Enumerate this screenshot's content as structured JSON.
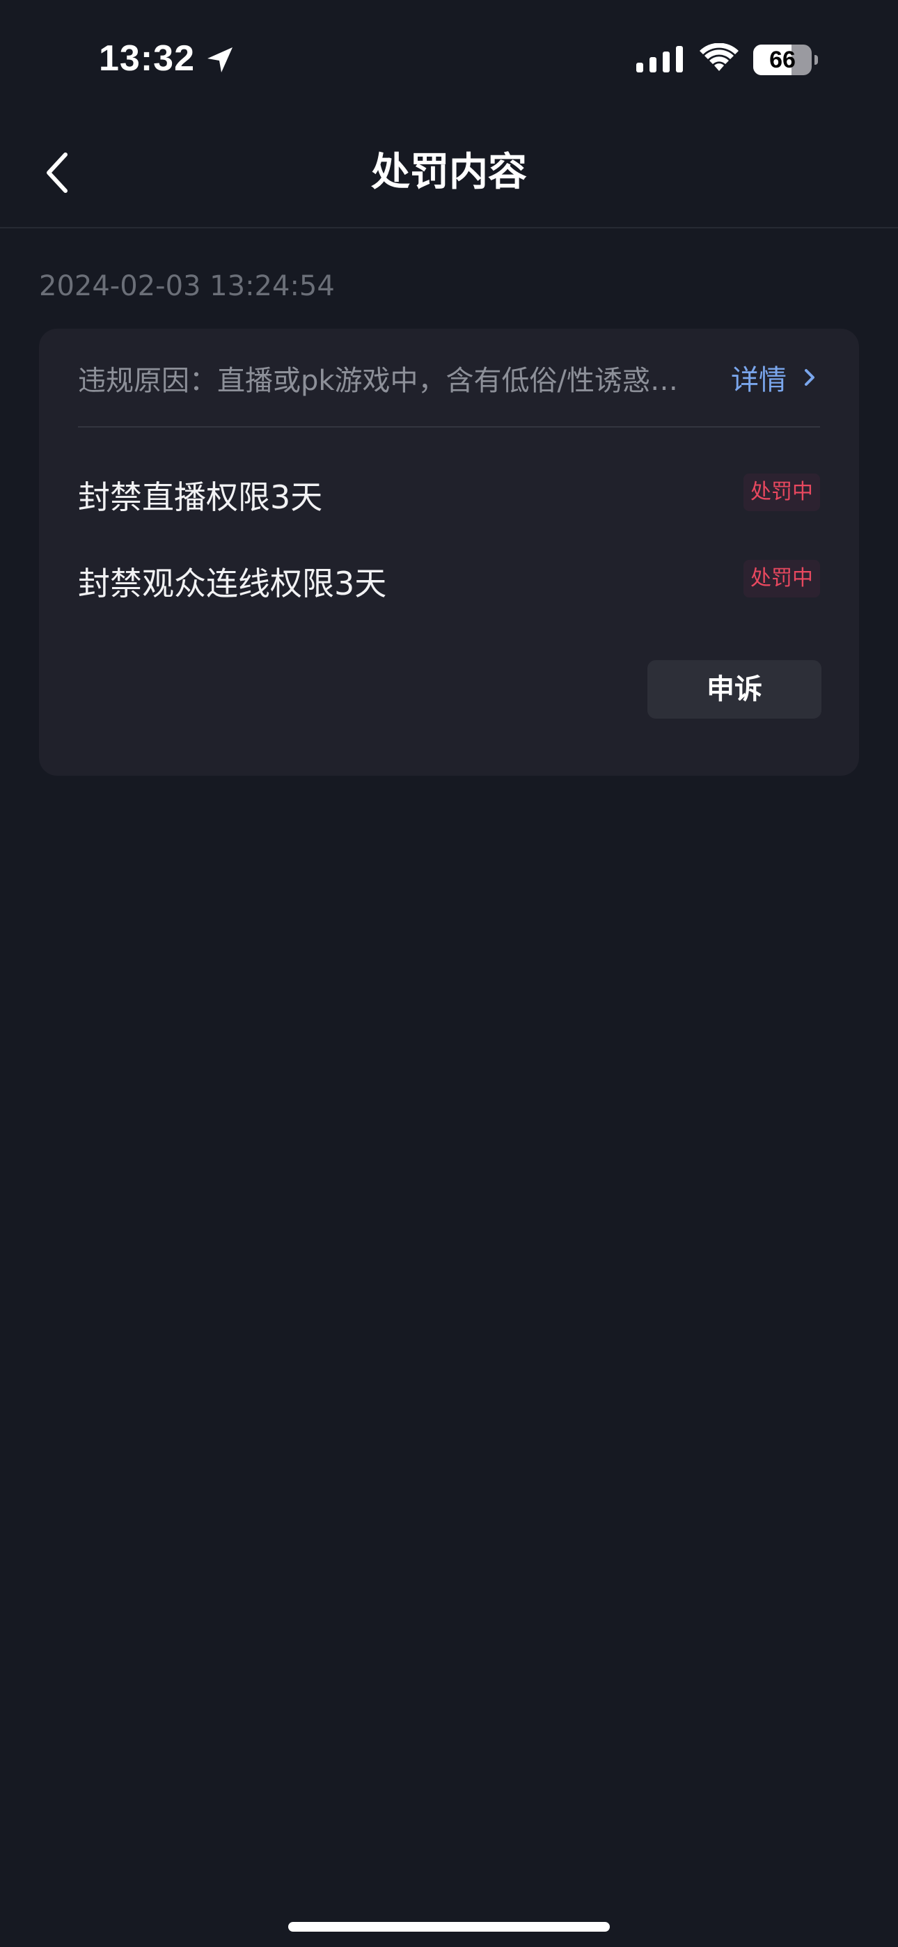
{
  "status_bar": {
    "time": "13:32",
    "battery_level": "66",
    "battery_fraction": 0.66,
    "icons": [
      "location-arrow-icon",
      "cellular-signal-icon",
      "wifi-icon",
      "battery-icon"
    ]
  },
  "nav": {
    "title": "处罚内容",
    "back_icon": "chevron-left-icon"
  },
  "record": {
    "timestamp": "2024-02-03 13:24:54",
    "reason": "违规原因：直播或pk游戏中，含有低俗/性诱惑内容",
    "details_label": "详情",
    "details_icon": "chevron-right-icon",
    "penalties": [
      {
        "label": "封禁直播权限3天",
        "status": "处罚中"
      },
      {
        "label": "封禁观众连线权限3天",
        "status": "处罚中"
      }
    ],
    "appeal_label": "申诉"
  },
  "colors": {
    "background": "#161922",
    "card": "#20212b",
    "link": "#7aa6ec",
    "status_red": "#e8485f",
    "muted_text": "#6b6f78"
  }
}
